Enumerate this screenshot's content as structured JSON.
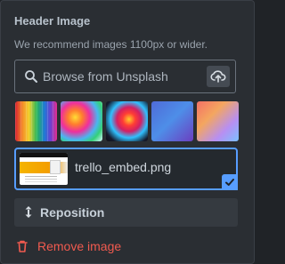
{
  "header": {
    "title": "Header Image",
    "subtitle": "We recommend images 1100px or wider."
  },
  "search": {
    "placeholder": "Browse from Unsplash",
    "icon": "search-icon",
    "upload_icon": "upload-cloud-icon"
  },
  "thumbnails": [
    {
      "name": "rainbow-fabric-thumbnail"
    },
    {
      "name": "color-smoke-thumbnail"
    },
    {
      "name": "abstract-paint-thumbnail"
    },
    {
      "name": "blue-purple-gradient-thumbnail"
    },
    {
      "name": "pastel-gradient-thumbnail"
    }
  ],
  "selected_image": {
    "filename": "trello_embed.png",
    "check_icon": "check-icon"
  },
  "actions": {
    "reposition_label": "Reposition",
    "reposition_icon": "up-down-arrows-icon",
    "remove_label": "Remove image",
    "remove_icon": "trash-icon"
  },
  "colors": {
    "accent": "#579dff",
    "danger": "#f05a4f",
    "panel": "#2a2e33"
  }
}
